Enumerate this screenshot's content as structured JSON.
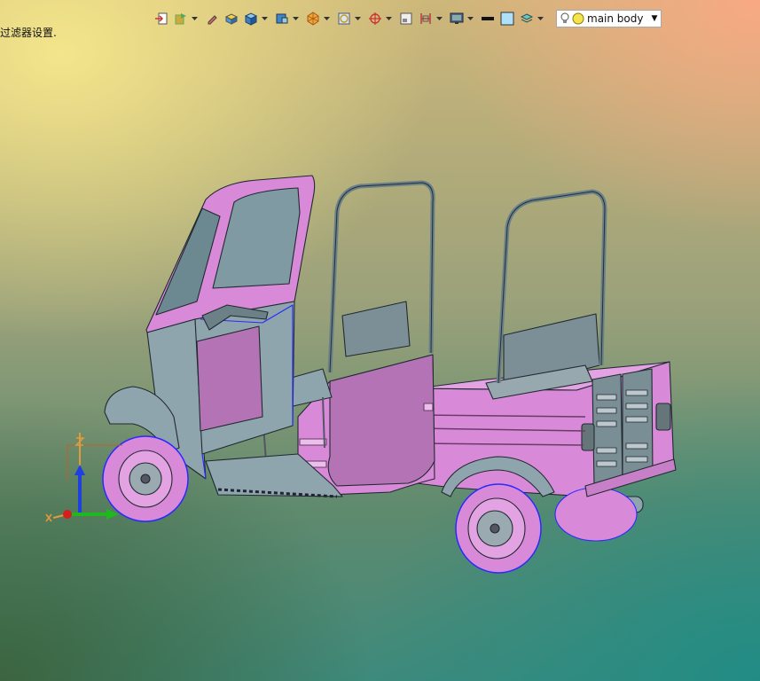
{
  "status": {
    "message": "过滤器设置."
  },
  "toolbar": {
    "icons": [
      {
        "name": "import-icon"
      },
      {
        "name": "layer-icon"
      },
      {
        "name": "edit-pen-icon"
      },
      {
        "name": "solid-icon"
      },
      {
        "name": "box-icon"
      },
      {
        "name": "shaded-cube-icon"
      },
      {
        "name": "part-orange-icon"
      },
      {
        "name": "circle-frame-icon"
      },
      {
        "name": "snap-point-icon"
      },
      {
        "name": "view-frame-icon"
      },
      {
        "name": "section-icon"
      },
      {
        "name": "display-icon"
      },
      {
        "name": "line-color-icon"
      },
      {
        "name": "fill-color-icon"
      },
      {
        "name": "layers-icon"
      }
    ],
    "reference_set": {
      "label": "main body"
    }
  },
  "model": {
    "name": "auto-rickshaw"
  },
  "colors": {
    "body_pink": "#d88ad8",
    "steel": "#8fa5ad",
    "edge_blue": "#2a2aff"
  }
}
